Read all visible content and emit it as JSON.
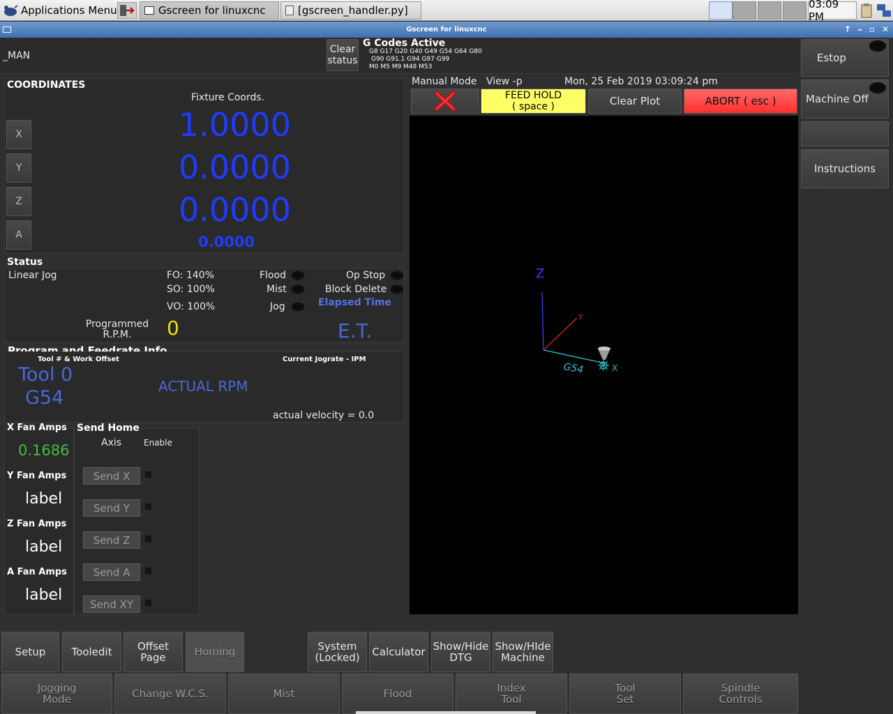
{
  "taskbar": {
    "app_menu_label": "Applications Menu",
    "tasks": [
      {
        "label": "Gscreen for linuxcnc",
        "active": true
      },
      {
        "label": "[gscreen_handler.py]",
        "active": false
      }
    ],
    "clock": "03:09 PM"
  },
  "window": {
    "title": "Gscreen for linuxcnc",
    "controls": [
      "↑",
      "–",
      "▫",
      "✕"
    ]
  },
  "header": {
    "mode_short": "_MAN",
    "clear_status_label": "Clear\nstatus",
    "gcodes_title": "G Codes Active",
    "gcodes_line1": "G8 G17 G20 G40 G49 G54 G64 G80",
    "gcodes_line2": "G90 G91.1 G94 G97 G99",
    "gcodes_line3": "M0 M5 M9 M48 M53"
  },
  "right_panel": {
    "estop_label": "Estop",
    "machine_off_label": "Machine Off",
    "blank_label": "",
    "instructions_label": "Instructions"
  },
  "coordinates": {
    "title": "COORDINATES",
    "subtitle": "Fixture Coords.",
    "axes": [
      {
        "name": "X",
        "value": "1.0000"
      },
      {
        "name": "Y",
        "value": "0.0000"
      },
      {
        "name": "Z",
        "value": "0.0000"
      },
      {
        "name": "A",
        "value": "0.0000"
      }
    ]
  },
  "status": {
    "title": "Status",
    "jog_mode": "Linear Jog",
    "fo": "FO: 140%",
    "so": "SO: 100%",
    "vo": "VO: 100%",
    "flood": "Flood",
    "mist": "Mist",
    "jog": "Jog",
    "op_stop": "Op Stop",
    "block_delete": "Block Delete",
    "elapsed_time_label": "Elapsed Time",
    "programmed_rpm_label": "Programmed\nR.P.M.",
    "programmed_rpm_value": "0",
    "et_value": "E.T."
  },
  "program": {
    "title": "Program and Feedrate Info.",
    "tool_offset_label": "Tool # & Work Offset",
    "jog_rate_label": "Current Jograte - IPM",
    "tool_value": "Tool 0",
    "offset_value": "G54",
    "actual_rpm": "ACTUAL RPM",
    "velocity": "actual velocity = 0.0"
  },
  "fans": [
    {
      "label": "X Fan Amps",
      "value": "0.1686"
    },
    {
      "label": "Y Fan Amps",
      "value": "label"
    },
    {
      "label": "Z Fan Amps",
      "value": "label"
    },
    {
      "label": "A Fan Amps",
      "value": "label"
    }
  ],
  "send_home": {
    "title": "Send Home",
    "axis_label": "Axis",
    "enable_label": "Enable",
    "buttons": [
      "Send X",
      "Send Y",
      "Send Z",
      "Send A",
      "Send XY"
    ]
  },
  "graphics": {
    "mode_label": "Manual Mode",
    "view_label": "View -p",
    "datetime": "Mon, 25 Feb 2019  03:09:24 pm",
    "feed_hold": "FEED HOLD\n( space )",
    "clear_plot": "Clear Plot",
    "abort": "ABORT ( esc )",
    "axis_z": "Z",
    "axis_y": "Y",
    "axis_x": "X",
    "wcs_label": "G54"
  },
  "bottom_row1": [
    {
      "label": "Setup",
      "dim": false
    },
    {
      "label": "Tooledit",
      "dim": false
    },
    {
      "label": "Offset\nPage",
      "dim": false
    },
    {
      "label": "Homing",
      "dim": true
    },
    {
      "label": "System\n(Locked)",
      "dim": false
    },
    {
      "label": "Calculator",
      "dim": false
    },
    {
      "label": "Show/Hide\nDTG",
      "dim": false
    },
    {
      "label": "Show/HIde\nMachine",
      "dim": false
    }
  ],
  "bottom_row2": [
    {
      "label": "Jogging\nMode"
    },
    {
      "label": "Change W.C.S."
    },
    {
      "label": "Mist"
    },
    {
      "label": "Flood"
    },
    {
      "label": "Index\nTool"
    },
    {
      "label": "Tool\nSet"
    },
    {
      "label": "Spindle\nControls"
    }
  ],
  "colors": {
    "coord_blue": "#1f3bff",
    "fan_green": "#3fbf3f",
    "rpm_yellow": "#f0e000",
    "abort_red": "#ff4444",
    "feedhold_yellow": "#ffff66"
  }
}
